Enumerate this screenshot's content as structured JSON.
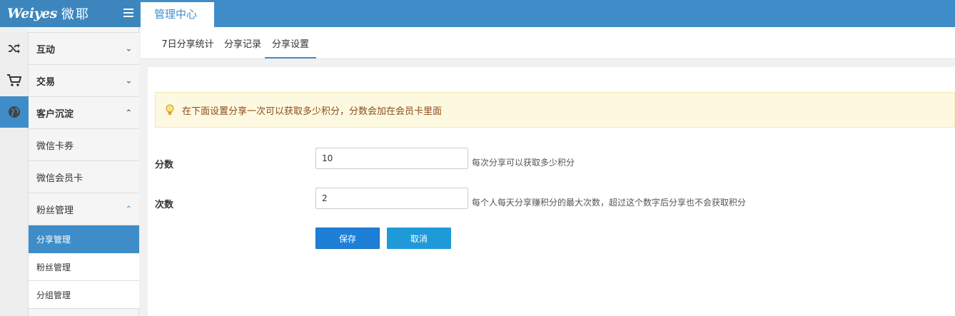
{
  "header": {
    "brand": "Weiyes",
    "brand_cn": "微耶",
    "menu_icon": "hamburger-icon",
    "active_tab": "管理中心"
  },
  "icon_strip": [
    {
      "icon": "shuffle-icon"
    },
    {
      "icon": "cart-icon"
    },
    {
      "icon": "globe-icon"
    }
  ],
  "sidebar": {
    "groups": [
      {
        "label": "互动",
        "expanded": false
      },
      {
        "label": "交易",
        "expanded": false
      },
      {
        "label": "客户沉淀",
        "expanded": true
      }
    ],
    "items": [
      {
        "label": "微信卡券"
      },
      {
        "label": "微信会员卡"
      },
      {
        "label": "粉丝管理",
        "expanded": true
      }
    ],
    "subitems": [
      {
        "label": "分享管理",
        "selected": true
      },
      {
        "label": "粉丝管理"
      },
      {
        "label": "分组管理"
      }
    ]
  },
  "subtabs": [
    {
      "label": "7日分享统计"
    },
    {
      "label": "分享记录"
    },
    {
      "label": "分享设置",
      "active": true
    }
  ],
  "alert": {
    "icon": "lightbulb-icon",
    "text": "在下面设置分享一次可以获取多少积分，分数会加在会员卡里面"
  },
  "form": {
    "score": {
      "label": "分数",
      "value": "10",
      "help": "每次分享可以获取多少积分"
    },
    "times": {
      "label": "次数",
      "value": "2",
      "help": "每个人每天分享赚积分的最大次数，超过这个数字后分享也不会获取积分"
    },
    "save_label": "保存",
    "cancel_label": "取消"
  },
  "colors": {
    "primary": "#3f8dc8",
    "save_button": "#1e7fd7",
    "cancel_button": "#1e9ad8",
    "alert_bg": "#fdf9e1",
    "alert_text": "#8a4c1d"
  }
}
